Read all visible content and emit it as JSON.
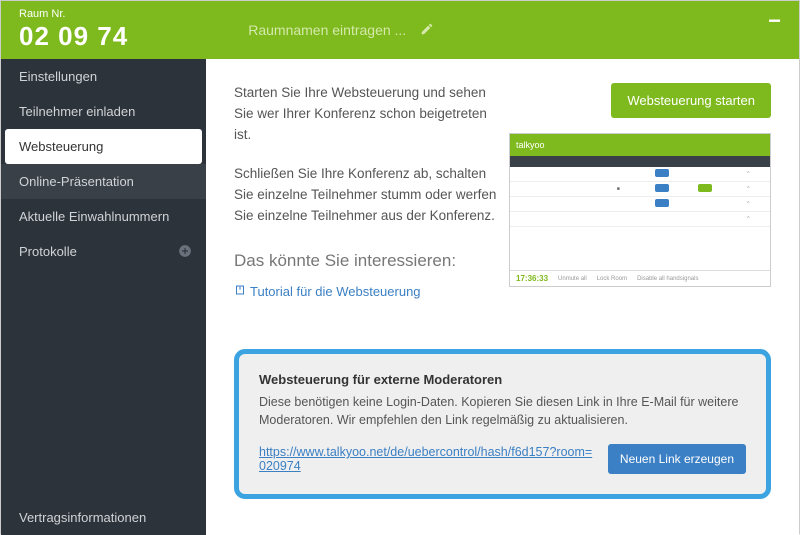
{
  "header": {
    "room_label": "Raum Nr.",
    "room_number": "02 09 74",
    "room_name_placeholder": "Raumnamen eintragen ..."
  },
  "sidebar": {
    "items": [
      {
        "label": "Einstellungen"
      },
      {
        "label": "Teilnehmer einladen"
      },
      {
        "label": "Websteuerung"
      },
      {
        "label": "Online-Präsentation"
      },
      {
        "label": "Aktuelle Einwahlnummern"
      },
      {
        "label": "Protokolle"
      }
    ],
    "footer_label": "Vertragsinformationen"
  },
  "content": {
    "para1": "Starten Sie Ihre Websteuerung und sehen Sie wer Ihrer Konferenz schon beigetreten ist.",
    "para2": "Schließen Sie Ihre Konferenz ab, schalten Sie einzelne Teilnehmer stumm oder werfen Sie einzelne Teilnehmer aus der Konferenz.",
    "start_btn": "Websteuerung starten",
    "interests_heading": "Das könnte Sie interessieren:",
    "tutorial_link": "Tutorial für die Websteuerung"
  },
  "preview": {
    "logo": "talkyoo",
    "time": "17:36:33",
    "footer_items": [
      "Unmute all",
      "Lock Room",
      "Disable all handsignals"
    ]
  },
  "callout": {
    "heading": "Websteuerung für externe Moderatoren",
    "text": "Diese benötigen keine Login-Daten. Kopieren Sie diesen Link in Ihre E-Mail für weitere Moderatoren. Wir empfehlen den Link regelmäßig zu aktualisieren.",
    "url": "https://www.talkyoo.net/de/uebercontrol/hash/f6d157?room=020974",
    "gen_btn": "Neuen Link erzeugen"
  }
}
